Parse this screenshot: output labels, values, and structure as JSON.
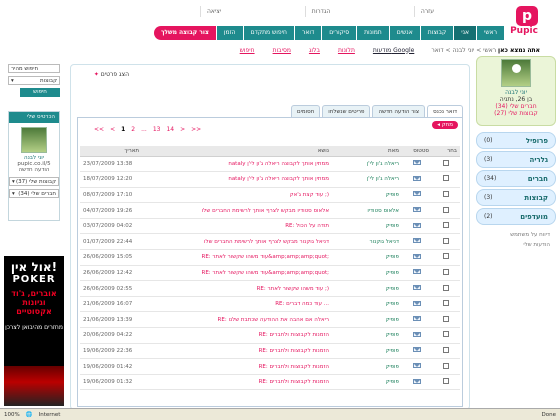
{
  "toplinks": [
    "יציאה",
    "הגדרות",
    "עזרה"
  ],
  "logo": {
    "letter": "p",
    "name": "Pupic"
  },
  "mainnav": [
    "ראשי",
    "אני",
    "קבוצות",
    "אנשים",
    "תמונות",
    "סיקורים",
    "דואר",
    "חיפוש מתקדם",
    "הזמן"
  ],
  "create_group": "צור קבוצה משלך",
  "breadcrumb": {
    "here": "אתה נמצא כאן",
    "path": "ראשי > יוני לבנה > דואר"
  },
  "subnav": {
    "google": "מודעות Google",
    "links": [
      "תלונות",
      "בלוג",
      "מסיבות",
      "חיפוש"
    ]
  },
  "profile": {
    "name": "יוני לבנה",
    "info": "בן 26, נתניה",
    "friends": "חברים שלי (34)",
    "groups": "קבוצות שלי (27)"
  },
  "sidemenu": [
    {
      "label": "פרופיל",
      "count": "(0)"
    },
    {
      "label": "גלריה",
      "count": "(3)"
    },
    {
      "label": "חברים",
      "count": "(34)"
    },
    {
      "label": "קבוצות",
      "count": "(3)"
    },
    {
      "label": "מועדפים",
      "count": "(2)"
    }
  ],
  "sideextra": [
    "דיווח על משתמש",
    "הודעות שלי"
  ],
  "search": {
    "placeholder": "חיפוש מהיר",
    "select": "קבוצות",
    "button": "חיפוש"
  },
  "contact": {
    "header": "הכרטיס שלי",
    "name": "יוני לבנה",
    "url": "pupic.co.il/5",
    "new_msg": "הודעה חדשה",
    "groups_sel": "קבוצות שלי (37)",
    "friends_sel": "חברים שלי (34)"
  },
  "ad": {
    "title": "אול אין!",
    "brand": "POKER",
    "line1": "אוברים, ג'וד",
    "line2": "וגיונות אקסוטיים",
    "foot": "מחזרים מהיבואן לצרכן"
  },
  "panel": {
    "title": "הצג פרטים"
  },
  "tabs": [
    "דואר נכנס",
    "צור הודעה חדשה",
    "פריטים שנשלחו",
    "חסומים"
  ],
  "delete_label": "מחק",
  "pager": [
    "<<",
    "<",
    "1",
    "2",
    "...",
    "13",
    "14",
    ">",
    ">>"
  ],
  "columns": [
    "בחר",
    "סטטוס",
    "מאת",
    "נושא",
    "תאריך"
  ],
  "rows": [
    {
      "from": "ריאלה ג'ון לי'ן",
      "subject": "nataly ממתין אותך לקבוצה ריאלה ג'ון לי'ן",
      "date": "23/07/2009 13:38"
    },
    {
      "from": "ריאלה ג'ון לי'ן",
      "subject": "nataly ממתין אותך לקבוצה ריאלה ג'ון לי'ן",
      "date": "18/07/2009 12:20"
    },
    {
      "from": "פופיק",
      "subject": "עוד קצת ג'אק ;)",
      "date": "08/07/2009 17:10"
    },
    {
      "from": "אלאוס סטודיו",
      "subject": "אלאוס סטודיו מבקש לצרף אותך לרשימת החברים שלו",
      "date": "04/07/2009 19:26"
    },
    {
      "from": "פופיק",
      "subject": "RE: תודה על הכול",
      "date": "03/07/2009 04:02"
    },
    {
      "from": "דניאל גוקנור",
      "subject": "דניאל גוקנור מבקש לצרף אותך לרשימת החברים שלו",
      "date": "01/07/2009 22:44"
    },
    {
      "from": "פופיק",
      "subject": "RE: עוד משהו שקשור לאתר&amp;amp;amp;quot;",
      "date": "26/06/2009 15:05"
    },
    {
      "from": "פופיק",
      "subject": "RE: עוד משהו שקשור לאתר&amp;amp;amp;quot;",
      "date": "26/06/2009 12:42"
    },
    {
      "from": "פופיק",
      "subject": "RE: עוד משהו שקשור לאתר ;)",
      "date": "26/06/2009 02:55"
    },
    {
      "from": "פופיק",
      "subject": "RE: עוד כמה דברים ...",
      "date": "21/06/2009 16:07"
    },
    {
      "from": "פופיק",
      "subject": "RE: ריאלה אם אהבה את ההודעה שכתבת שלנו",
      "date": "21/06/2009 13:39"
    },
    {
      "from": "פופיק",
      "subject": "RE: הזמנות לקבוצות ולחברים",
      "date": "20/06/2009 04:22"
    },
    {
      "from": "פופיק",
      "subject": "RE: הזמנות לקבוצות ולחברים",
      "date": "19/06/2009 22:36"
    },
    {
      "from": "פופיק",
      "subject": "RE: הזמנות לקבוצות ולחברים",
      "date": "19/06/2009 01:42"
    },
    {
      "from": "פופיק",
      "subject": "RE: הזמנות לקבוצות ולחברים",
      "date": "19/06/2009 01:32"
    }
  ],
  "statusbar": {
    "zoom": "100%",
    "zone": "Internet",
    "done": "Done"
  }
}
